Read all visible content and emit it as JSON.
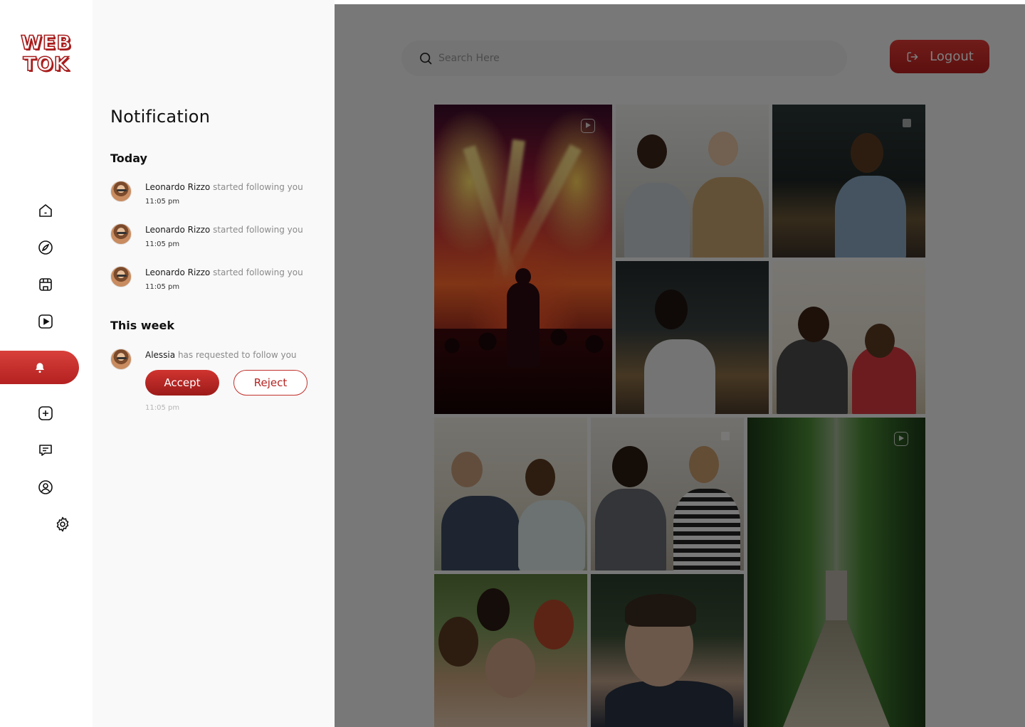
{
  "brand": {
    "line1": "WEB",
    "line2": "TOK",
    "accent": "#b81f1e"
  },
  "nav": {
    "items": [
      {
        "name": "home",
        "icon": "home-icon"
      },
      {
        "name": "explore",
        "icon": "compass-icon"
      },
      {
        "name": "shop",
        "icon": "store-icon"
      },
      {
        "name": "videos",
        "icon": "play-icon"
      },
      {
        "name": "notifications",
        "icon": "bell-icon",
        "active": true
      },
      {
        "name": "create",
        "icon": "plus-square-icon"
      },
      {
        "name": "messages",
        "icon": "message-icon"
      },
      {
        "name": "profile",
        "icon": "user-circle-icon"
      },
      {
        "name": "settings",
        "icon": "gear-icon"
      }
    ]
  },
  "notifications": {
    "title": "Notification",
    "today_label": "Today",
    "week_label": "This week",
    "today": [
      {
        "user": "Leonardo Rizzo",
        "action": "started following you",
        "time": "11:05 pm"
      },
      {
        "user": "Leonardo Rizzo",
        "action": "started following you",
        "time": "11:05 pm"
      },
      {
        "user": "Leonardo Rizzo",
        "action": "started following you",
        "time": "11:05 pm"
      }
    ],
    "week": [
      {
        "user": "Alessia",
        "action": "has requested to follow you",
        "time": "11:05 pm",
        "accept_label": "Accept",
        "reject_label": "Reject"
      }
    ]
  },
  "search": {
    "placeholder": "Search Here",
    "value": ""
  },
  "header": {
    "logout_label": "Logout"
  },
  "feed": {
    "tiles": [
      {
        "id": "concert",
        "type": "video"
      },
      {
        "id": "friends",
        "type": "photo"
      },
      {
        "id": "bar-woman",
        "type": "multi"
      },
      {
        "id": "laugh",
        "type": "photo"
      },
      {
        "id": "couple1",
        "type": "photo"
      },
      {
        "id": "couple2",
        "type": "photo"
      },
      {
        "id": "women",
        "type": "multi"
      },
      {
        "id": "forest",
        "type": "video"
      },
      {
        "id": "selfie",
        "type": "photo"
      },
      {
        "id": "man",
        "type": "photo"
      }
    ]
  }
}
